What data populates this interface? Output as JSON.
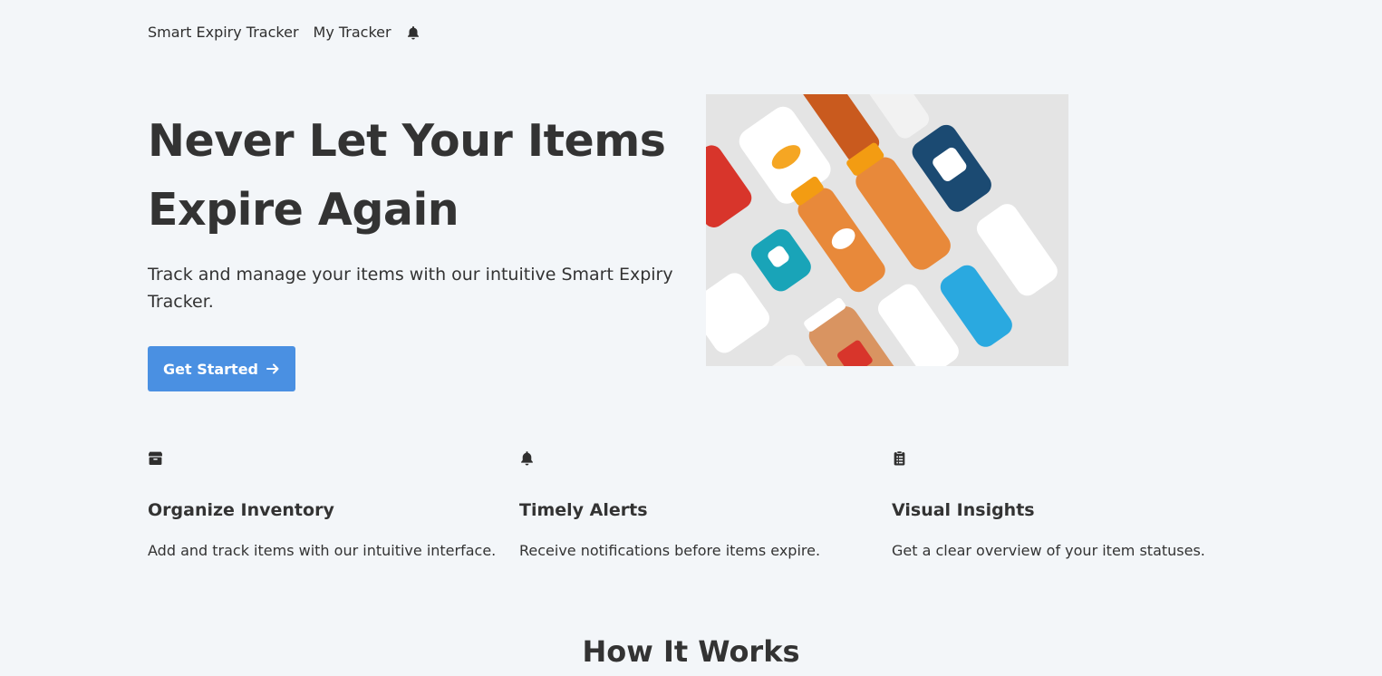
{
  "nav": {
    "brand": "Smart Expiry Tracker",
    "my_tracker": "My Tracker",
    "notification_icon": "bell-icon"
  },
  "hero": {
    "title_line1": "Never Let Your Items",
    "title_line2": "Expire Again",
    "subtitle": "Track and manage your items with our intuitive Smart Expiry Tracker.",
    "cta_label": "Get Started",
    "cta_icon": "arrow-right-icon",
    "image_alt": "product bottles and containers"
  },
  "features": [
    {
      "icon": "box-icon",
      "title": "Organize Inventory",
      "text": "Add and track items with our intuitive interface."
    },
    {
      "icon": "bell-icon",
      "title": "Timely Alerts",
      "text": "Receive notifications before items expire."
    },
    {
      "icon": "clipboard-list-icon",
      "title": "Visual Insights",
      "text": "Get a clear overview of your item statuses."
    }
  ],
  "how_it_works": {
    "title": "How It Works"
  },
  "colors": {
    "background": "#f3f6f9",
    "accent": "#4a90e2",
    "text": "#333333"
  }
}
